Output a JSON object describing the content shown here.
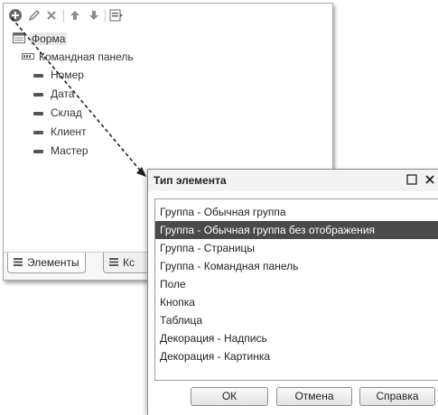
{
  "form_tree": {
    "root_label": "Форма",
    "items": [
      {
        "label": "Командная панель",
        "icon": "command-panel-icon"
      },
      {
        "label": "Номер",
        "icon": "field-icon"
      },
      {
        "label": "Дата",
        "icon": "field-icon"
      },
      {
        "label": "Склад",
        "icon": "field-icon"
      },
      {
        "label": "Клиент",
        "icon": "field-icon"
      },
      {
        "label": "Мастер",
        "icon": "field-icon"
      }
    ]
  },
  "tabs": [
    {
      "label": "Элементы"
    },
    {
      "label": "Кс"
    }
  ],
  "dialog": {
    "title": "Тип элемента",
    "items": [
      "Группа - Обычная группа",
      "Группа - Обычная группа без отображения",
      "Группа - Страницы",
      "Группа - Командная панель",
      "Поле",
      "Кнопка",
      "Таблица",
      "Декорация - Надпись",
      "Декорация - Картинка"
    ],
    "selected_item": "Группа - Обычная группа без отображения",
    "buttons": {
      "ok": "ОК",
      "cancel": "Отмена",
      "help": "Справка"
    }
  }
}
